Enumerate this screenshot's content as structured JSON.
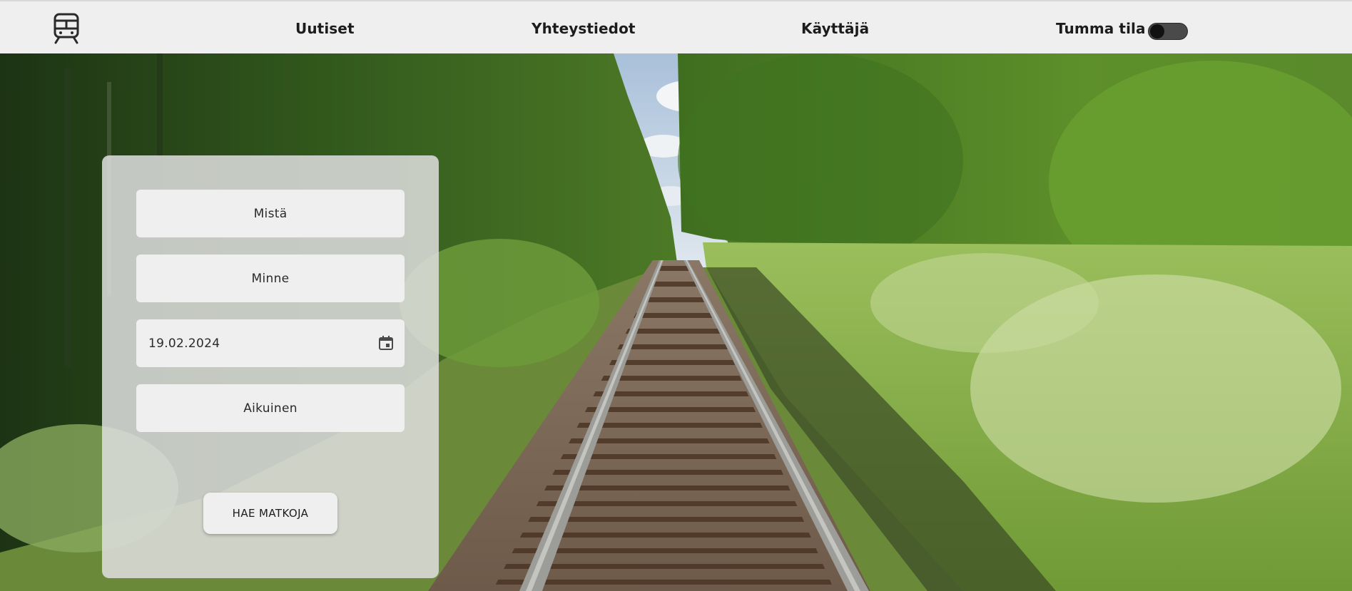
{
  "nav": {
    "logo_icon": "train-icon",
    "links": [
      "Uutiset",
      "Yhteystiedot",
      "Käyttäjä"
    ],
    "dark_mode_label": "Tumma tila",
    "dark_mode_on": false
  },
  "search": {
    "from_placeholder": "Mistä",
    "to_placeholder": "Minne",
    "date_value": "19.02.2024",
    "date_icon": "calendar-icon",
    "passenger_type": "Aikuinen",
    "submit_label": "HAE MATKOJA"
  },
  "background": {
    "description_icon": "railway-forest-photo"
  }
}
